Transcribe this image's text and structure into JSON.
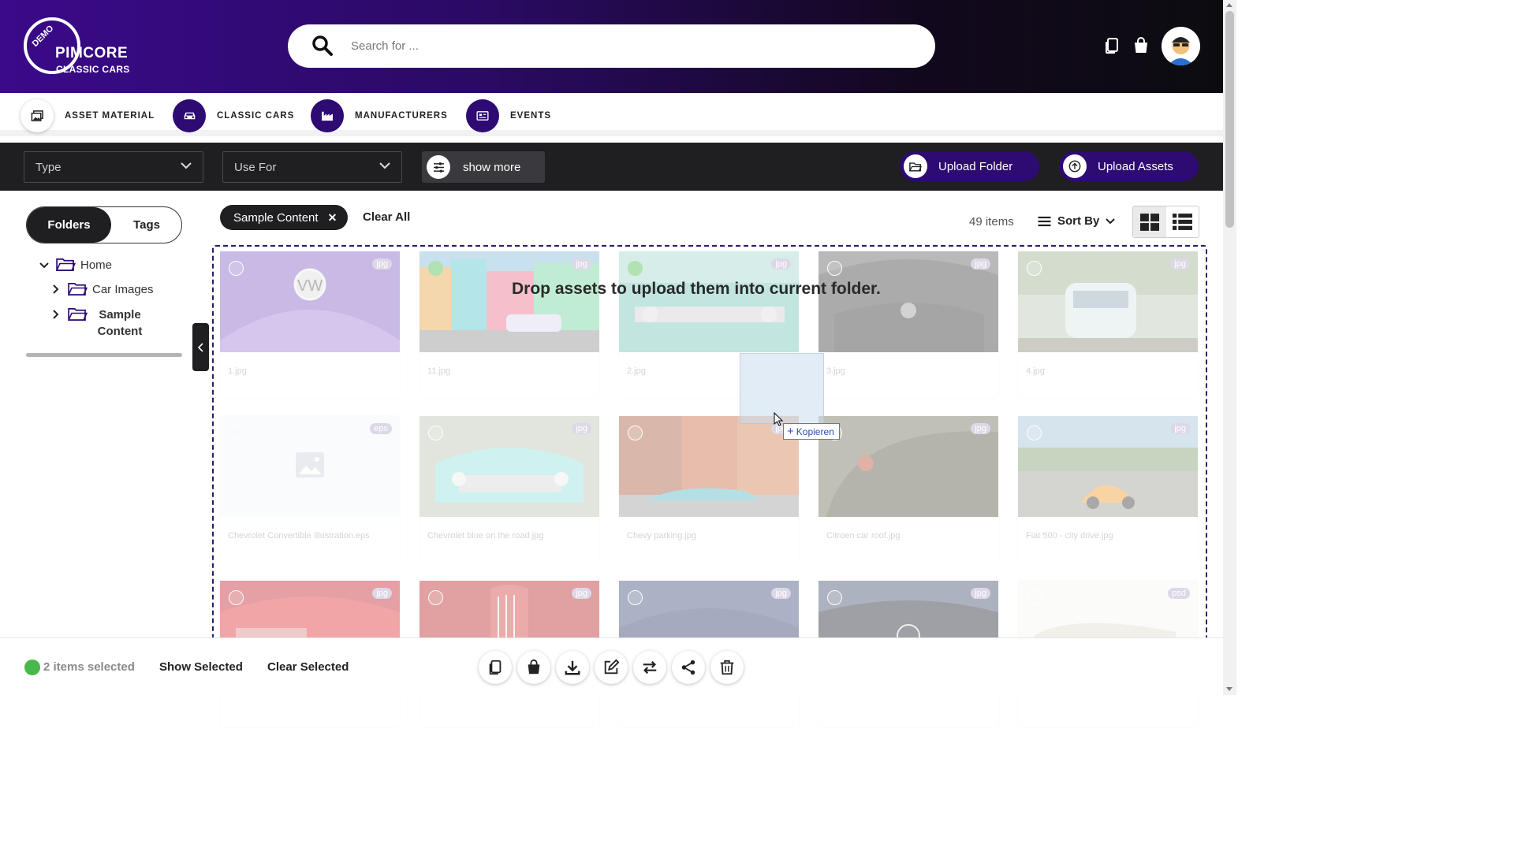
{
  "brand": {
    "demo": "DEMO",
    "name": "PIMCORE",
    "subtitle": "CLASSIC CARS"
  },
  "search": {
    "placeholder": "Search for ..."
  },
  "nav": {
    "items": [
      {
        "label": "ASSET MATERIAL",
        "icon": "image-gallery-icon"
      },
      {
        "label": "CLASSIC CARS",
        "icon": "car-icon"
      },
      {
        "label": "MANUFACTURERS",
        "icon": "factory-icon"
      },
      {
        "label": "EVENTS",
        "icon": "event-news-icon"
      }
    ]
  },
  "filters": {
    "type_placeholder": "Type",
    "usefor_placeholder": "Use For",
    "show_more": "show more",
    "upload_folder": "Upload Folder",
    "upload_assets": "Upload Assets"
  },
  "sidebar": {
    "tabs": {
      "folders": "Folders",
      "tags": "Tags",
      "active": "Folders"
    },
    "tree": [
      {
        "label": "Home",
        "expanded": true,
        "level": 0
      },
      {
        "label": "Car Images",
        "expanded": false,
        "level": 1
      },
      {
        "label": "Sample Content",
        "expanded": false,
        "level": 1,
        "selected": true
      }
    ]
  },
  "results": {
    "active_filter": "Sample Content",
    "clear_all": "Clear All",
    "count": "49 items",
    "sort_label": "Sort By",
    "view_mode": "grid"
  },
  "dropzone": {
    "message": "Drop assets to upload them into current folder."
  },
  "drag": {
    "tooltip": "Kopieren"
  },
  "assets": [
    {
      "name": "1.jpg",
      "type": "jpg",
      "selected": false
    },
    {
      "name": "11.jpg",
      "type": "jpg",
      "selected": true
    },
    {
      "name": "2.jpg",
      "type": "jpg",
      "selected": true
    },
    {
      "name": "3.jpg",
      "type": "jpg",
      "selected": false
    },
    {
      "name": "4.jpg",
      "type": "jpg",
      "selected": false
    },
    {
      "name": "Chevrolet Convertible Illustration.eps",
      "type": "eps",
      "selected": false
    },
    {
      "name": "Chevrolet blue on the road.jpg",
      "type": "jpg",
      "selected": false
    },
    {
      "name": "Chevy parking.jpg",
      "type": "jpg",
      "selected": false
    },
    {
      "name": "Citroen car roof.jpg",
      "type": "jpg",
      "selected": false
    },
    {
      "name": "Fiat 500 - city drive.jpg",
      "type": "jpg",
      "selected": false
    },
    {
      "name": "",
      "type": "jpg",
      "selected": false
    },
    {
      "name": "",
      "type": "jpg",
      "selected": false
    },
    {
      "name": "",
      "type": "jpg",
      "selected": false
    },
    {
      "name": "",
      "type": "jpg",
      "selected": false
    },
    {
      "name": "",
      "type": "psd",
      "selected": false
    }
  ],
  "bottom": {
    "selected_text": "2 items selected",
    "show_selected": "Show Selected",
    "clear_selected": "Clear Selected",
    "actions": [
      "copy-icon",
      "bag-icon",
      "download-icon",
      "edit-icon",
      "swap-icon",
      "share-icon",
      "trash-icon"
    ]
  },
  "colors": {
    "brand_purple": "#2e0a73",
    "dark_bar": "#1f1f22",
    "selected_green": "#49b84a"
  }
}
